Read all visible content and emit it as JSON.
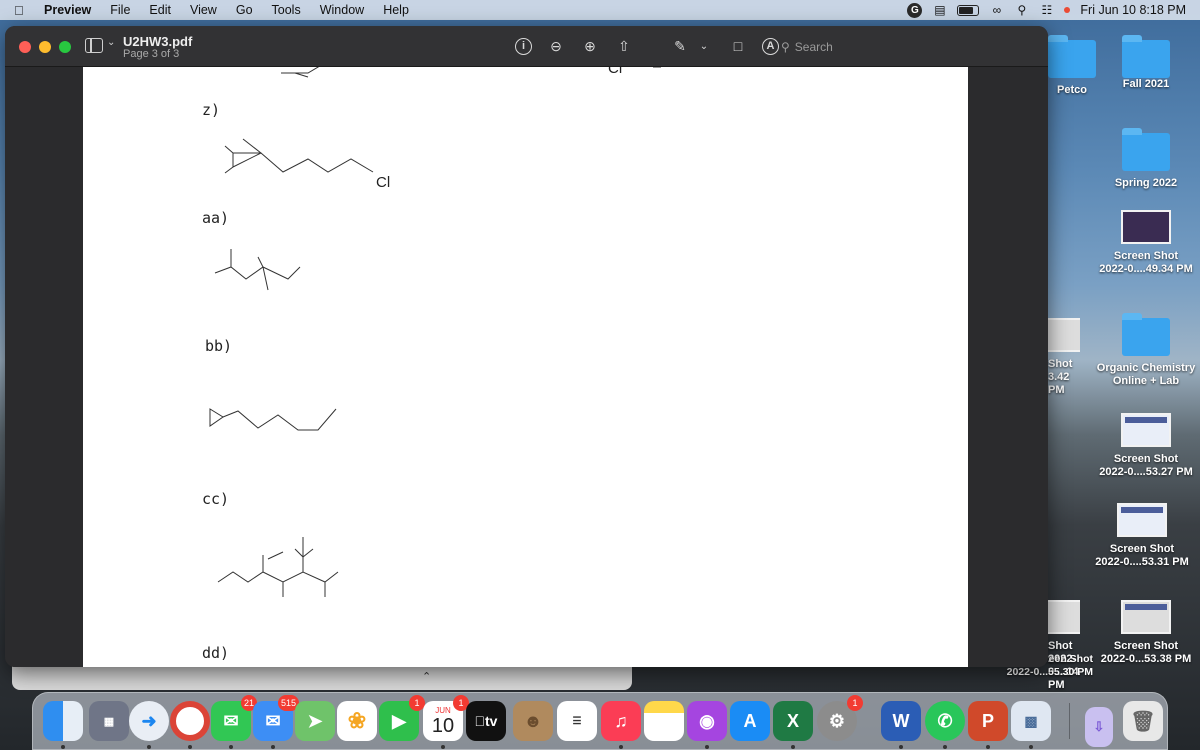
{
  "menubar": {
    "app_name": "Preview",
    "items": [
      "File",
      "Edit",
      "View",
      "Go",
      "Tools",
      "Window",
      "Help"
    ],
    "clock": "Fri Jun 10  8:18 PM"
  },
  "window": {
    "doc_title": "U2HW3.pdf",
    "page_indicator": "Page 3 of 3",
    "search_placeholder": "Search"
  },
  "document": {
    "labels": {
      "z": "z)",
      "aa": "aa)",
      "bb": "bb)",
      "cc": "cc)",
      "dd": "dd)"
    },
    "substituent_z": "Cl",
    "substituent_top": "Cl"
  },
  "desktop": {
    "icons": [
      {
        "label": "Petco",
        "kind": "folder"
      },
      {
        "label": "Fall 2021",
        "kind": "folder"
      },
      {
        "label": "Spring 2022",
        "kind": "folder"
      },
      {
        "label": "Screen Shot\n2022-0....49.34 PM",
        "kind": "screenshot"
      },
      {
        "label": "Organic Chemistry\nOnline + Lab",
        "kind": "folder"
      },
      {
        "label": "Shot\n3.42 PM",
        "kind": "screenshot"
      },
      {
        "label": "Screen Shot\n2022-0....53.27 PM",
        "kind": "screenshot"
      },
      {
        "label": "Screen Shot\n2022-0....53.31 PM",
        "kind": "screenshot"
      },
      {
        "label": "Shot\n2022-0....14.38 PM",
        "kind": "screenshot"
      },
      {
        "label": "Screen Shot\n2022-0...55.30 PM",
        "kind": "screenshot"
      },
      {
        "label": "Screen Shot\n2022-0...53.38 PM",
        "kind": "screenshot"
      }
    ]
  },
  "dock": {
    "apps": [
      {
        "name": "Finder",
        "color": "#2f8ef0"
      },
      {
        "name": "Launchpad",
        "color": "#8a8fa0"
      },
      {
        "name": "Safari",
        "color": "#1c86f0"
      },
      {
        "name": "Chrome",
        "color": "#f1f1f1"
      },
      {
        "name": "Messages",
        "color": "#31c754",
        "badge": "21"
      },
      {
        "name": "Mail",
        "color": "#3d8ef5",
        "badge": "515"
      },
      {
        "name": "Maps",
        "color": "#6fc36a"
      },
      {
        "name": "Photos",
        "color": "#ffffff"
      },
      {
        "name": "FaceTime",
        "color": "#2fbf4c",
        "badge": "1"
      },
      {
        "name": "Calendar",
        "color": "#ffffff",
        "badge": "1",
        "month": "JUN",
        "day": "10"
      },
      {
        "name": "TV",
        "color": "#111111",
        "text": "tv"
      },
      {
        "name": "Contacts",
        "color": "#b08a5e"
      },
      {
        "name": "Reminders",
        "color": "#ffffff"
      },
      {
        "name": "Music",
        "color": "#fb3d55"
      },
      {
        "name": "Notes",
        "color": "#ffd84a"
      },
      {
        "name": "Podcasts",
        "color": "#a545e0"
      },
      {
        "name": "App Store",
        "color": "#1a8cf5"
      },
      {
        "name": "Excel",
        "color": "#1f7a44",
        "text": "X"
      },
      {
        "name": "System Preferences",
        "color": "#8c8c8c",
        "badge": "1"
      },
      {
        "name": "Word",
        "color": "#2b5db5",
        "text": "W"
      },
      {
        "name": "WhatsApp",
        "color": "#29c65a"
      },
      {
        "name": "PowerPoint",
        "color": "#d0492a",
        "text": "P"
      },
      {
        "name": "Preview",
        "color": "#dfe7f2"
      },
      {
        "name": "Downloads",
        "color": "#c9c0f0"
      },
      {
        "name": "Trash",
        "color": "#e8e8e8"
      }
    ]
  }
}
